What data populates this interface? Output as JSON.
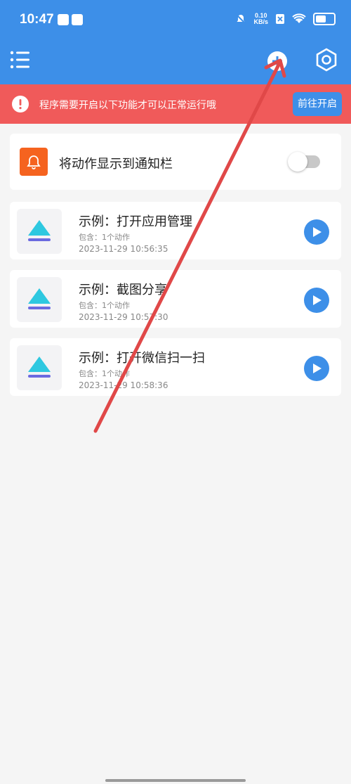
{
  "status_bar": {
    "time": "10:47",
    "net_speed_value": "0.10",
    "net_speed_unit": "KB/s"
  },
  "toolbar": {
    "menu_icon": "menu-list-icon",
    "add_icon": "add-circle-icon",
    "settings_icon": "settings-hexagon-icon"
  },
  "banner": {
    "message": "程序需要开启以下功能才可以正常运行哦",
    "button_label": "前往开启"
  },
  "notify_card": {
    "label": "将动作显示到通知栏",
    "toggle_on": false
  },
  "actions": [
    {
      "title": "示例：打开应用管理",
      "subtitle": "包含：1个动作",
      "date": "2023-11-29 10:56:35"
    },
    {
      "title": "示例：截图分享",
      "subtitle": "包含：1个动作",
      "date": "2023-11-29 10:57:30"
    },
    {
      "title": "示例：打开微信扫一扫",
      "subtitle": "包含：1个动作",
      "date": "2023-11-29 10:58:36"
    }
  ],
  "colors": {
    "primary": "#3d8fe8",
    "banner": "#f05a5a",
    "bell": "#f5631f",
    "annotation_arrow": "#e04848"
  }
}
